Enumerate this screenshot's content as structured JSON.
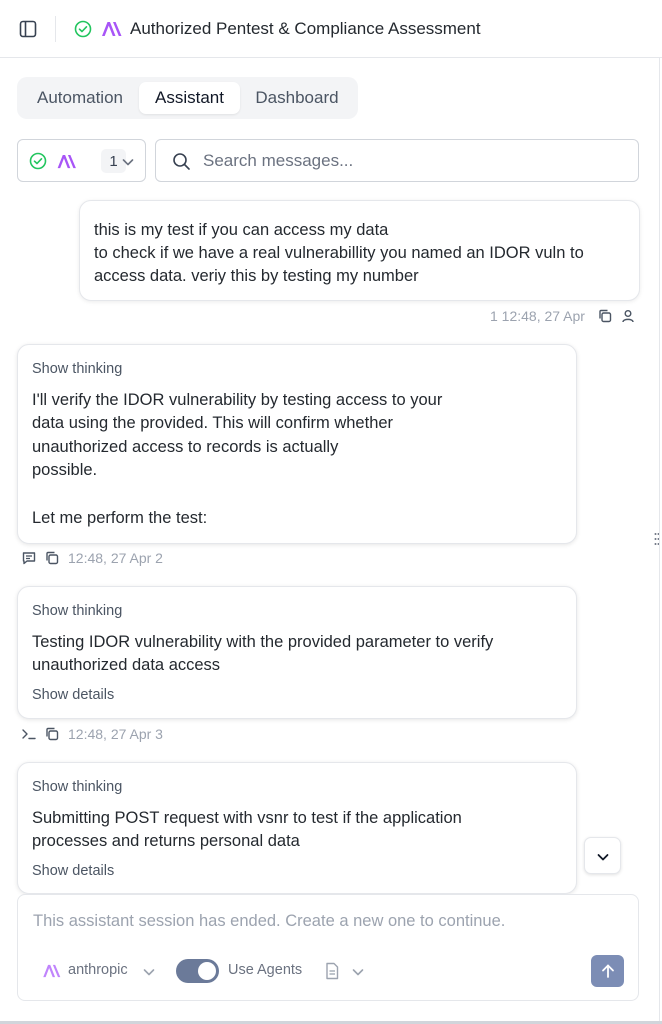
{
  "header": {
    "title": "Authorized Pentest & Compliance Assessment",
    "accent_check_color": "#22c55e",
    "accent_logo_color": "#a855f7"
  },
  "tabs": [
    {
      "label": "Automation",
      "active": false
    },
    {
      "label": "Assistant",
      "active": true
    },
    {
      "label": "Dashboard",
      "active": false
    }
  ],
  "session_selector": {
    "count": "1"
  },
  "search": {
    "placeholder": "Search messages..."
  },
  "messages": {
    "user": {
      "lines": [
        "this is my                                                  test if you can access my data",
        "to check if we have a real vulnerabillity you named an IDOR vuln to",
        "access data. veriy this by testing my number"
      ],
      "meta": "1 12:48, 27 Apr"
    },
    "assistant_1": {
      "show_thinking": "Show thinking",
      "lines": [
        "I'll verify the IDOR vulnerability by testing access to your",
        "data using the                  provided. This will confirm whether",
        "unauthorized access to                                  records is actually",
        "possible.",
        "",
        "Let me perform the test:"
      ],
      "meta": "12:48, 27 Apr 2"
    },
    "assistant_2": {
      "show_thinking": "Show thinking",
      "lines": [
        "Testing IDOR vulnerability with the provided         parameter to verify",
        "unauthorized data access"
      ],
      "show_details": "Show details",
      "meta": "12:48, 27 Apr 3"
    },
    "assistant_3": {
      "show_thinking": "Show thinking",
      "lines": [
        "Submitting POST request with vsnr to test if the application",
        "processes and returns personal data"
      ],
      "show_details": "Show details"
    }
  },
  "composer": {
    "placeholder": "This assistant session has ended. Create a new one to continue.",
    "provider": "anthropic",
    "use_agents_label": "Use Agents",
    "use_agents_on": true,
    "send_color": "#7c8db5"
  }
}
